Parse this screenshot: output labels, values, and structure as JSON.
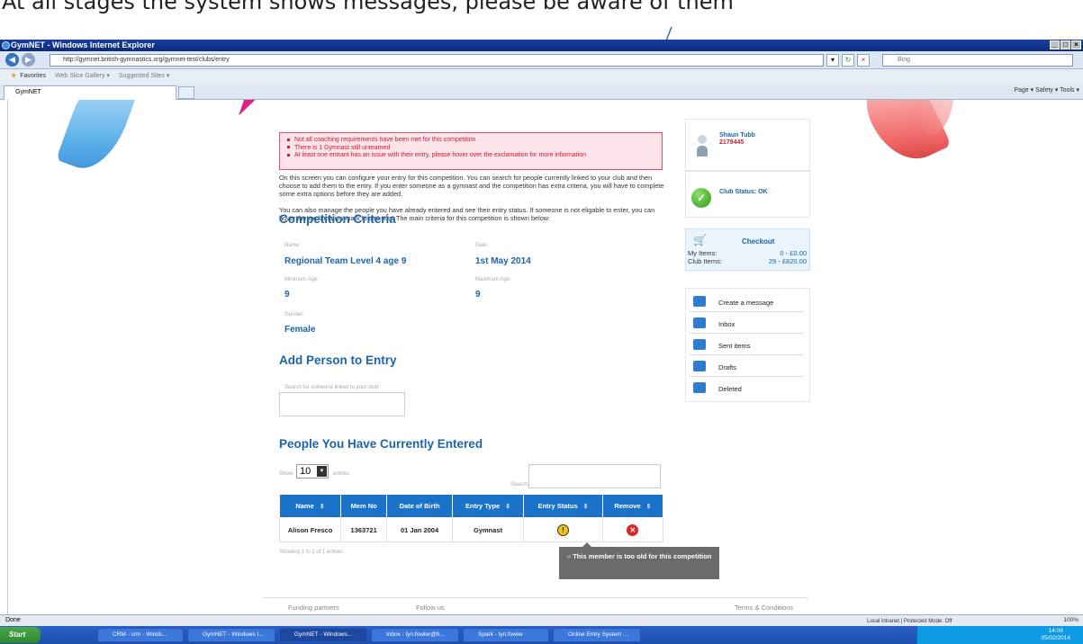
{
  "caption": "At all stages the system shows messages, please be aware of them",
  "window": {
    "title": "GymNET - Windows Internet Explorer",
    "url": "http://gymnet.british-gymnastics.org/gymnet-test/clubs/entry",
    "search_placeholder": "Bing",
    "favorites_label": "Favorites",
    "fav_items": [
      "Web Slice Gallery ▾",
      "Suggested Sites ▾"
    ],
    "tab_label": "GymNET",
    "command_bar": "Page ▾  Safety ▾  Tools ▾"
  },
  "alerts": [
    "Not all coaching requirements have been met for this competition",
    "There is 1 Gymnast still unteamed",
    "At least one entrant has an issue with their entry, please hover over the exclamation for more information"
  ],
  "intro": {
    "p1": "On this screen you can configure your entry for this competition. You can search for people currently linked to your club and then choose to add them to the entry. If you enter someone as a gymnast and the competition has extra criteria, you will have to complete some extra options before they are added.",
    "p2": "You can also manage the people you have already entered and see their entry status. If someone is not eligable to enter, you can hover the exclamation mark to see why. The main criteria for this competition is shown below:"
  },
  "criteria": {
    "heading": "Competition Criteria",
    "name_label": "Name:",
    "name": "Regional Team Level 4 age 9",
    "date_label": "Date:",
    "date": "1st May 2014",
    "min_age_label": "Minimum Age:",
    "min_age": "9",
    "max_age_label": "Maximum Age:",
    "max_age": "9",
    "gender_label": "Gender:",
    "gender": "Female"
  },
  "add_person": {
    "heading": "Add Person to Entry",
    "search_label": "Search for someone linked to your club:"
  },
  "entered": {
    "heading": "People You Have Currently Entered",
    "show_label": "Show",
    "show_value": "10",
    "entries_label": "entries",
    "search_label": "Search:",
    "columns": [
      "Name",
      "Mem No",
      "Date of Birth",
      "Entry Type",
      "Entry Status",
      "Remove"
    ],
    "rows": [
      {
        "name": "Alison Fresco",
        "mem_no": "1363721",
        "dob": "01 Jan 2004",
        "type": "Gymnast",
        "status_icon": "warning-icon",
        "remove_icon": "remove-icon"
      }
    ],
    "showing": "Showing 1 to 1 of 1 entries",
    "tooltip": "This member is too old for this competition"
  },
  "user": {
    "name": "Shaun Tubb",
    "id": "2179445"
  },
  "club_status": "Club Status: OK",
  "checkout": {
    "title": "Checkout",
    "my_items_label": "My Items:",
    "my_items": "0  -  £0.00",
    "club_items_label": "Club Items:",
    "club_items": "29  -  £820.00"
  },
  "messages": [
    "Create a message",
    "Inbox",
    "Sent items",
    "Drafts",
    "Deleted"
  ],
  "footer": {
    "funding": "Funding partners",
    "follow": "Follow us",
    "terms": "Terms & Conditions"
  },
  "status_bar": {
    "left": "Done",
    "zone": "Local intranet | Protected Mode: Off",
    "zoom": "100%"
  },
  "taskbar": {
    "start": "Start",
    "tasks": [
      "CRM - crm - Winds...",
      "GymNET - Windows I...",
      "GymNET - Windows...",
      "Inbox - lyn.fowler@b...",
      "Spark - lyn.fowler",
      "Online Entry System ..."
    ],
    "time": "14:09",
    "date": "05/02/2014"
  },
  "colors": {
    "accent": "#1b65a8",
    "table_header": "#1b73c9",
    "alert_red": "#d01c2c"
  }
}
